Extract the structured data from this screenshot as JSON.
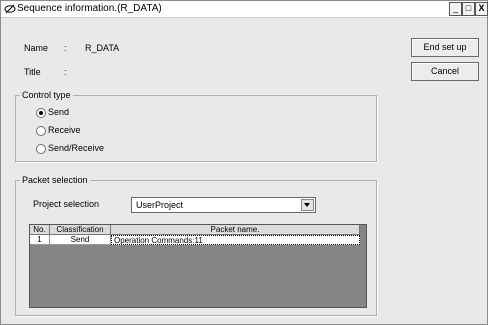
{
  "window": {
    "title": "Sequence information.(R_DATA)",
    "controls": {
      "minimize": "_",
      "maximize": "□",
      "close": "X"
    }
  },
  "info": {
    "name_label": "Name",
    "name_sep": ":",
    "name_value": "R_DATA",
    "title_label": "Title",
    "title_sep": ":",
    "title_value": ""
  },
  "buttons": {
    "end_setup": "End set up",
    "cancel": "Cancel"
  },
  "control_type": {
    "label": "Control type",
    "options": [
      {
        "label": "Send",
        "selected": true
      },
      {
        "label": "Receive",
        "selected": false
      },
      {
        "label": "Send/Receive",
        "selected": false
      }
    ]
  },
  "packet_selection": {
    "label": "Packet selection",
    "project_label": "Project selection",
    "project_value": "UserProject",
    "table": {
      "columns": [
        "No.",
        "Classification",
        "Packet name."
      ],
      "rows": [
        {
          "no": "1",
          "classification": "Send",
          "packet_name": "Operation Commands:11"
        }
      ]
    }
  }
}
